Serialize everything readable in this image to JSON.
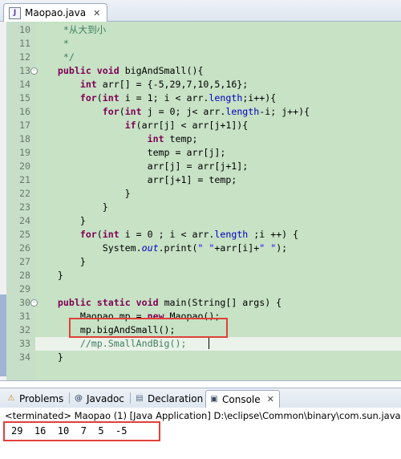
{
  "editor": {
    "tab_label": "Maopao.java",
    "tab_icon": "java-file-icon",
    "tab_close": "✕",
    "lines": [
      {
        "n": "10",
        "html": "<span class='cm'>     *从大到小</span>"
      },
      {
        "n": "11",
        "html": "<span class='cm'>     *</span>"
      },
      {
        "n": "12",
        "html": "<span class='cm'>     */</span>"
      },
      {
        "n": "13",
        "fold": "-",
        "html": "    <span class='kw'>public</span> <span class='kw'>void</span> bigAndSmall(){"
      },
      {
        "n": "14",
        "html": "        <span class='kw'>int</span> arr[] = {-5,29,7,10,5,16};"
      },
      {
        "n": "15",
        "html": "        <span class='kw'>for</span>(<span class='kw'>int</span> i = 1; i &lt; arr.<span class='fd'>length</span>;i++){"
      },
      {
        "n": "16",
        "html": "            <span class='kw'>for</span>(<span class='kw'>int</span> j = 0; j&lt; arr.<span class='fd'>length</span>-i; j++){"
      },
      {
        "n": "17",
        "html": "                <span class='kw'>if</span>(arr[j] &lt; arr[j+1]){"
      },
      {
        "n": "18",
        "html": "                    <span class='kw'>int</span> temp;"
      },
      {
        "n": "19",
        "html": "                    temp = arr[j];"
      },
      {
        "n": "20",
        "html": "                    arr[j] = arr[j+1];"
      },
      {
        "n": "21",
        "html": "                    arr[j+1] = temp;"
      },
      {
        "n": "22",
        "html": "                }"
      },
      {
        "n": "23",
        "html": "            }"
      },
      {
        "n": "24",
        "html": "        }"
      },
      {
        "n": "25",
        "html": "        <span class='kw'>for</span>(<span class='kw'>int</span> i = 0 ; i &lt; arr.<span class='fd'>length</span> ;i ++) {"
      },
      {
        "n": "26",
        "html": "            System.<span class='fd' style='font-style:italic'>out</span>.print(<span class='st'>\" \"</span>+arr[i]+<span class='st'>\" \"</span>);"
      },
      {
        "n": "27",
        "html": "        }"
      },
      {
        "n": "28",
        "html": "    }"
      },
      {
        "n": "29",
        "html": ""
      },
      {
        "n": "30",
        "fold": "-",
        "html": "    <span class='kw'>public</span> <span class='kw'>static</span> <span class='kw'>void</span> main(String[] args) {"
      },
      {
        "n": "31",
        "html": "        Maopao mp = <span class='kw'>new</span> Maopao();"
      },
      {
        "n": "32",
        "html": "        mp.bigAndSmall();"
      },
      {
        "n": "33",
        "current": true,
        "html": "<span class='cm'>        //mp.SmallAndBig();</span>"
      },
      {
        "n": "34",
        "html": "    }"
      }
    ]
  },
  "panel": {
    "tabs": [
      {
        "label": "Problems",
        "icon": "problems-icon",
        "glyph": "⚠"
      },
      {
        "label": "Javadoc",
        "icon": "javadoc-icon",
        "glyph": "@"
      },
      {
        "label": "Declaration",
        "icon": "declaration-icon",
        "glyph": "▤"
      },
      {
        "label": "Console",
        "icon": "console-icon",
        "glyph": "▣",
        "active": true
      }
    ],
    "close_glyph": "✕"
  },
  "console": {
    "status": "<terminated> Maopao (1) [Java Application] D:\\eclipse\\Common\\binary\\com.sun.java",
    "output": "29  16  10  7  5  -5"
  }
}
